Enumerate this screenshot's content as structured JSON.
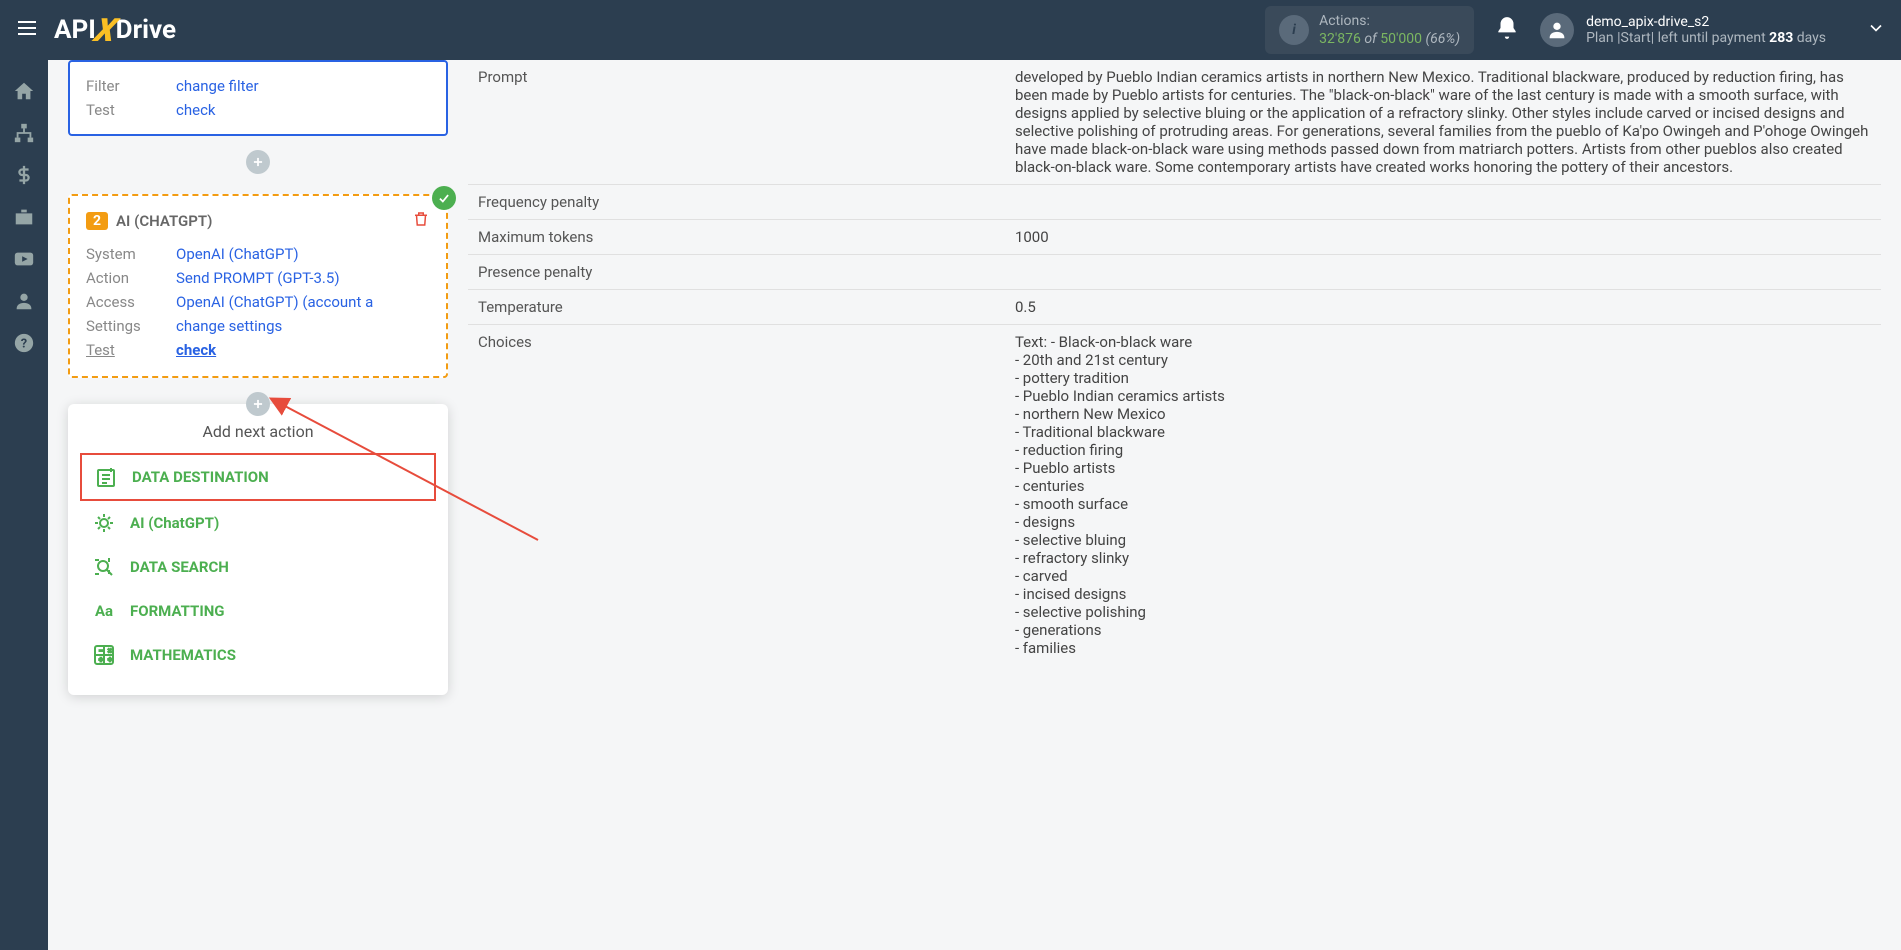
{
  "header": {
    "logo": {
      "api": "API",
      "x": "X",
      "drive": "Drive"
    },
    "actions": {
      "label": "Actions:",
      "count": "32'876",
      "of": " of ",
      "max": "50'000",
      "pct": " (66%)"
    },
    "user": {
      "name": "demo_apix-drive_s2",
      "plan_prefix": "Plan |Start| left until payment ",
      "plan_num": "283",
      "plan_suffix": " days"
    }
  },
  "blue_card": {
    "rows": [
      {
        "label": "Filter",
        "value": "change filter"
      },
      {
        "label": "Test",
        "value": "check"
      }
    ]
  },
  "orange_card": {
    "badge": "2",
    "title": "AI (CHATGPT)",
    "rows": [
      {
        "label": "System",
        "value": "OpenAI (ChatGPT)"
      },
      {
        "label": "Action",
        "value": "Send PROMPT (GPT-3.5)"
      },
      {
        "label": "Access",
        "value": "OpenAI (ChatGPT) (account a"
      },
      {
        "label": "Settings",
        "value": "change settings"
      },
      {
        "label": "Test",
        "value": "check",
        "label_underline": true,
        "value_bold": true
      }
    ]
  },
  "action_menu": {
    "title": "Add next action",
    "items": [
      {
        "label": "DATA DESTINATION",
        "highlighted": true
      },
      {
        "label": "AI (ChatGPT)"
      },
      {
        "label": "DATA SEARCH"
      },
      {
        "label": "FORMATTING"
      },
      {
        "label": "MATHEMATICS"
      }
    ]
  },
  "right_table": {
    "rows": [
      {
        "label": "Prompt",
        "value": "developed by Pueblo Indian ceramics artists in northern New Mexico. Traditional blackware, produced by reduction firing, has been made by Pueblo artists for centuries. The \"black-on-black\" ware of the last century is made with a smooth surface, with designs applied by selective bluing or the application of a refractory slinky. Other styles include carved or incised designs and selective polishing of protruding areas. For generations, several families from the pueblo of Ka'po Owingeh and P'ohoge Owingeh have made black-on-black ware using methods passed down from matriarch potters. Artists from other pueblos also created black-on-black ware. Some contemporary artists have created works honoring the pottery of their ancestors."
      },
      {
        "label": "Frequency penalty",
        "value": ""
      },
      {
        "label": "Maximum tokens",
        "value": "1000"
      },
      {
        "label": "Presence penalty",
        "value": ""
      },
      {
        "label": "Temperature",
        "value": "0.5"
      },
      {
        "label": "Choices",
        "value": "Text: - Black-on-black ware\n- 20th and 21st century\n- pottery tradition\n- Pueblo Indian ceramics artists\n- northern New Mexico\n- Traditional blackware\n- reduction firing\n- Pueblo artists\n- centuries\n- smooth surface\n- designs\n- selective bluing\n- refractory slinky\n- carved\n- incised designs\n- selective polishing\n- generations\n- families"
      }
    ]
  }
}
